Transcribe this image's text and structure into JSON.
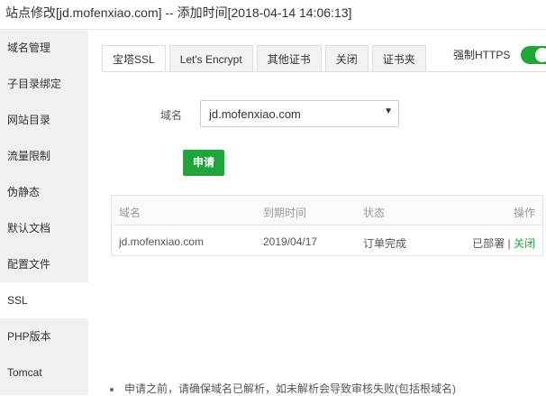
{
  "window": {
    "title": "站点修改[jd.mofenxiao.com] -- 添加时间[2018-04-14 14:06:13]"
  },
  "sidebar": {
    "items": [
      {
        "label": "域名管理"
      },
      {
        "label": "子目录绑定"
      },
      {
        "label": "网站目录"
      },
      {
        "label": "流量限制"
      },
      {
        "label": "伪静态"
      },
      {
        "label": "默认文档"
      },
      {
        "label": "配置文件"
      },
      {
        "label": "SSL"
      },
      {
        "label": "PHP版本"
      },
      {
        "label": "Tomcat"
      }
    ],
    "active": "SSL"
  },
  "tabs": [
    {
      "label": "宝塔SSL"
    },
    {
      "label": "Let's Encrypt"
    },
    {
      "label": "其他证书"
    },
    {
      "label": "关闭"
    },
    {
      "label": "证书夹"
    }
  ],
  "force_https": {
    "label": "强制HTTPS",
    "enabled": true
  },
  "form": {
    "domain_label": "域名",
    "domain_value": "jd.mofenxiao.com",
    "apply_label": "申请"
  },
  "table": {
    "headers": [
      "域名",
      "到期时间",
      "状态",
      "操作"
    ],
    "rows": [
      {
        "domain": "jd.mofenxiao.com",
        "expires": "2019/04/17",
        "status": "订单完成",
        "deployed": "已部署",
        "separator": "|",
        "close": "关闭"
      }
    ]
  },
  "note": "申请之前，请确保域名已解析，如未解析会导致审核失败(包括根域名)",
  "colors": {
    "accent": "#20a53a"
  }
}
